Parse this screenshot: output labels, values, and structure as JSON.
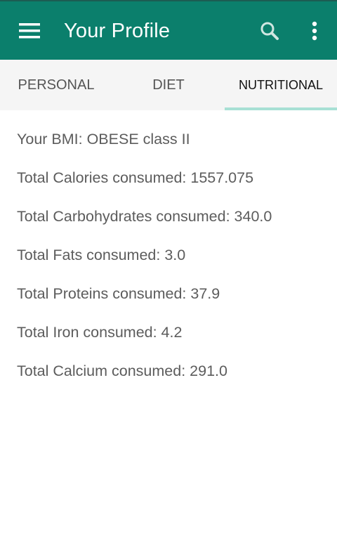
{
  "toolbar": {
    "title": "Your Profile",
    "background_color": "#0b7f6c",
    "icons": [
      "menu-icon",
      "search-icon",
      "more-vert-icon"
    ]
  },
  "tabs": [
    {
      "label": "PERSONAL",
      "active": false
    },
    {
      "label": "DIET",
      "active": false
    },
    {
      "label": "NUTRITIONAL",
      "active": true
    }
  ],
  "accent_color": "#a8e0d5",
  "stats": [
    "Your BMI: OBESE class II",
    "Total Calories consumed: 1557.075",
    "Total Carbohydrates consumed: 340.0",
    "Total Fats consumed: 3.0",
    "Total Proteins consumed: 37.9",
    "Total Iron consumed: 4.2",
    "Total Calcium consumed: 291.0"
  ]
}
